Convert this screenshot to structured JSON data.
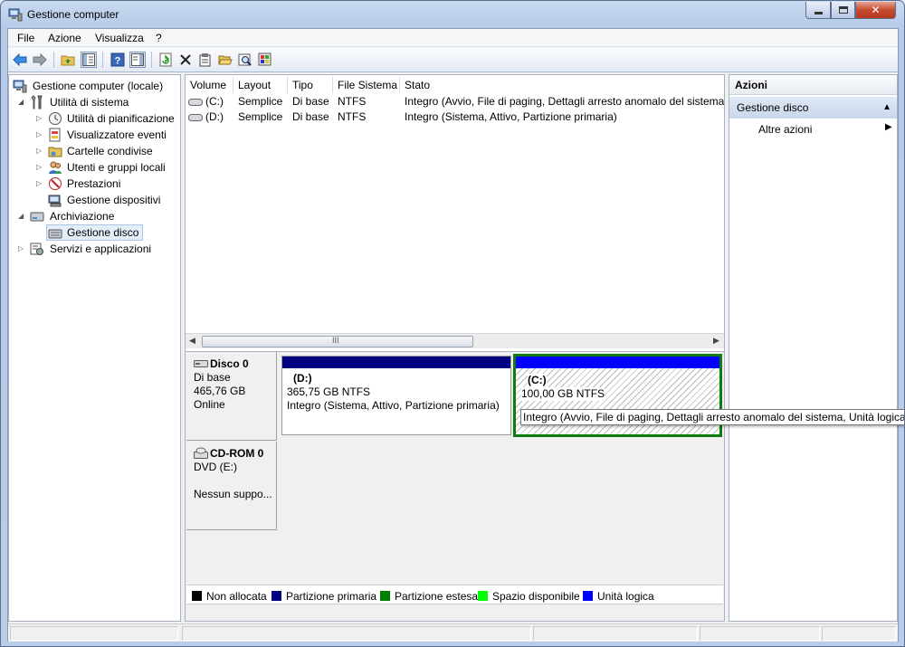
{
  "window": {
    "title": "Gestione computer"
  },
  "menu": [
    "File",
    "Azione",
    "Visualizza",
    "?"
  ],
  "toolbar": {
    "icons": [
      "back-arrow-icon",
      "forward-arrow-icon",
      "up-folder-icon",
      "show-hide-tree-icon",
      "help-icon",
      "properties-pane-icon",
      "refresh-icon",
      "delete-icon",
      "properties-icon",
      "open-folder-icon",
      "search-icon",
      "disk-settings-icon"
    ]
  },
  "tree": {
    "items": [
      {
        "label": "Gestione computer (locale)",
        "icon": "computer-management-icon"
      },
      {
        "label": "Utilità di sistema",
        "icon": "system-tools-icon"
      },
      {
        "label": "Utilità di pianificazione",
        "icon": "clock-icon"
      },
      {
        "label": "Visualizzatore eventi",
        "icon": "event-viewer-icon"
      },
      {
        "label": "Cartelle condivise",
        "icon": "shared-folder-icon"
      },
      {
        "label": "Utenti e gruppi locali",
        "icon": "users-icon"
      },
      {
        "label": "Prestazioni",
        "icon": "performance-icon"
      },
      {
        "label": "Gestione dispositivi",
        "icon": "device-manager-icon"
      },
      {
        "label": "Archiviazione",
        "icon": "storage-icon"
      },
      {
        "label": "Gestione disco",
        "icon": "disk-management-icon"
      },
      {
        "label": "Servizi e applicazioni",
        "icon": "services-icon"
      }
    ]
  },
  "volumes": {
    "columns": [
      "Volume",
      "Layout",
      "Tipo",
      "File Sistema",
      "Stato"
    ],
    "rows": [
      [
        "(C:)",
        "Semplice",
        "Di base",
        "NTFS",
        "Integro (Avvio, File di paging, Dettagli arresto anomalo del sistema, Unità logica)"
      ],
      [
        "(D:)",
        "Semplice",
        "Di base",
        "NTFS",
        "Integro (Sistema, Attivo, Partizione primaria)"
      ]
    ],
    "scroll_grip": "III"
  },
  "disks": [
    {
      "name": "Disco 0",
      "type": "Di base",
      "size": "465,76 GB",
      "status": "Online",
      "partitions": [
        {
          "letter": "(D:)",
          "size": "365,75 GB NTFS",
          "status": "Integro (Sistema, Attivo, Partizione primaria)",
          "color": "#000080"
        },
        {
          "letter": "(C:)",
          "size": "100,00 GB NTFS",
          "status": "Integro (Avvio, File di paging, Dettagli arresto anomalo del sistema, Unità logica)",
          "color": "#0000ff"
        }
      ]
    },
    {
      "name": "CD-ROM 0",
      "type": "DVD (E:)",
      "status": "Nessun suppo..."
    }
  ],
  "tooltip": "Integro (Avvio, File di paging, Dettagli arresto anomalo del sistema, Unità logica)",
  "legend": [
    {
      "label": "Non allocata",
      "color": "#000000"
    },
    {
      "label": "Partizione primaria",
      "color": "#000080"
    },
    {
      "label": "Partizione estesa",
      "color": "#008000"
    },
    {
      "label": "Spazio disponibile",
      "color": "#00ff00"
    },
    {
      "label": "Unità logica",
      "color": "#0000ff"
    }
  ],
  "actions": {
    "header": "Azioni",
    "section": "Gestione disco",
    "more": "Altre azioni"
  }
}
